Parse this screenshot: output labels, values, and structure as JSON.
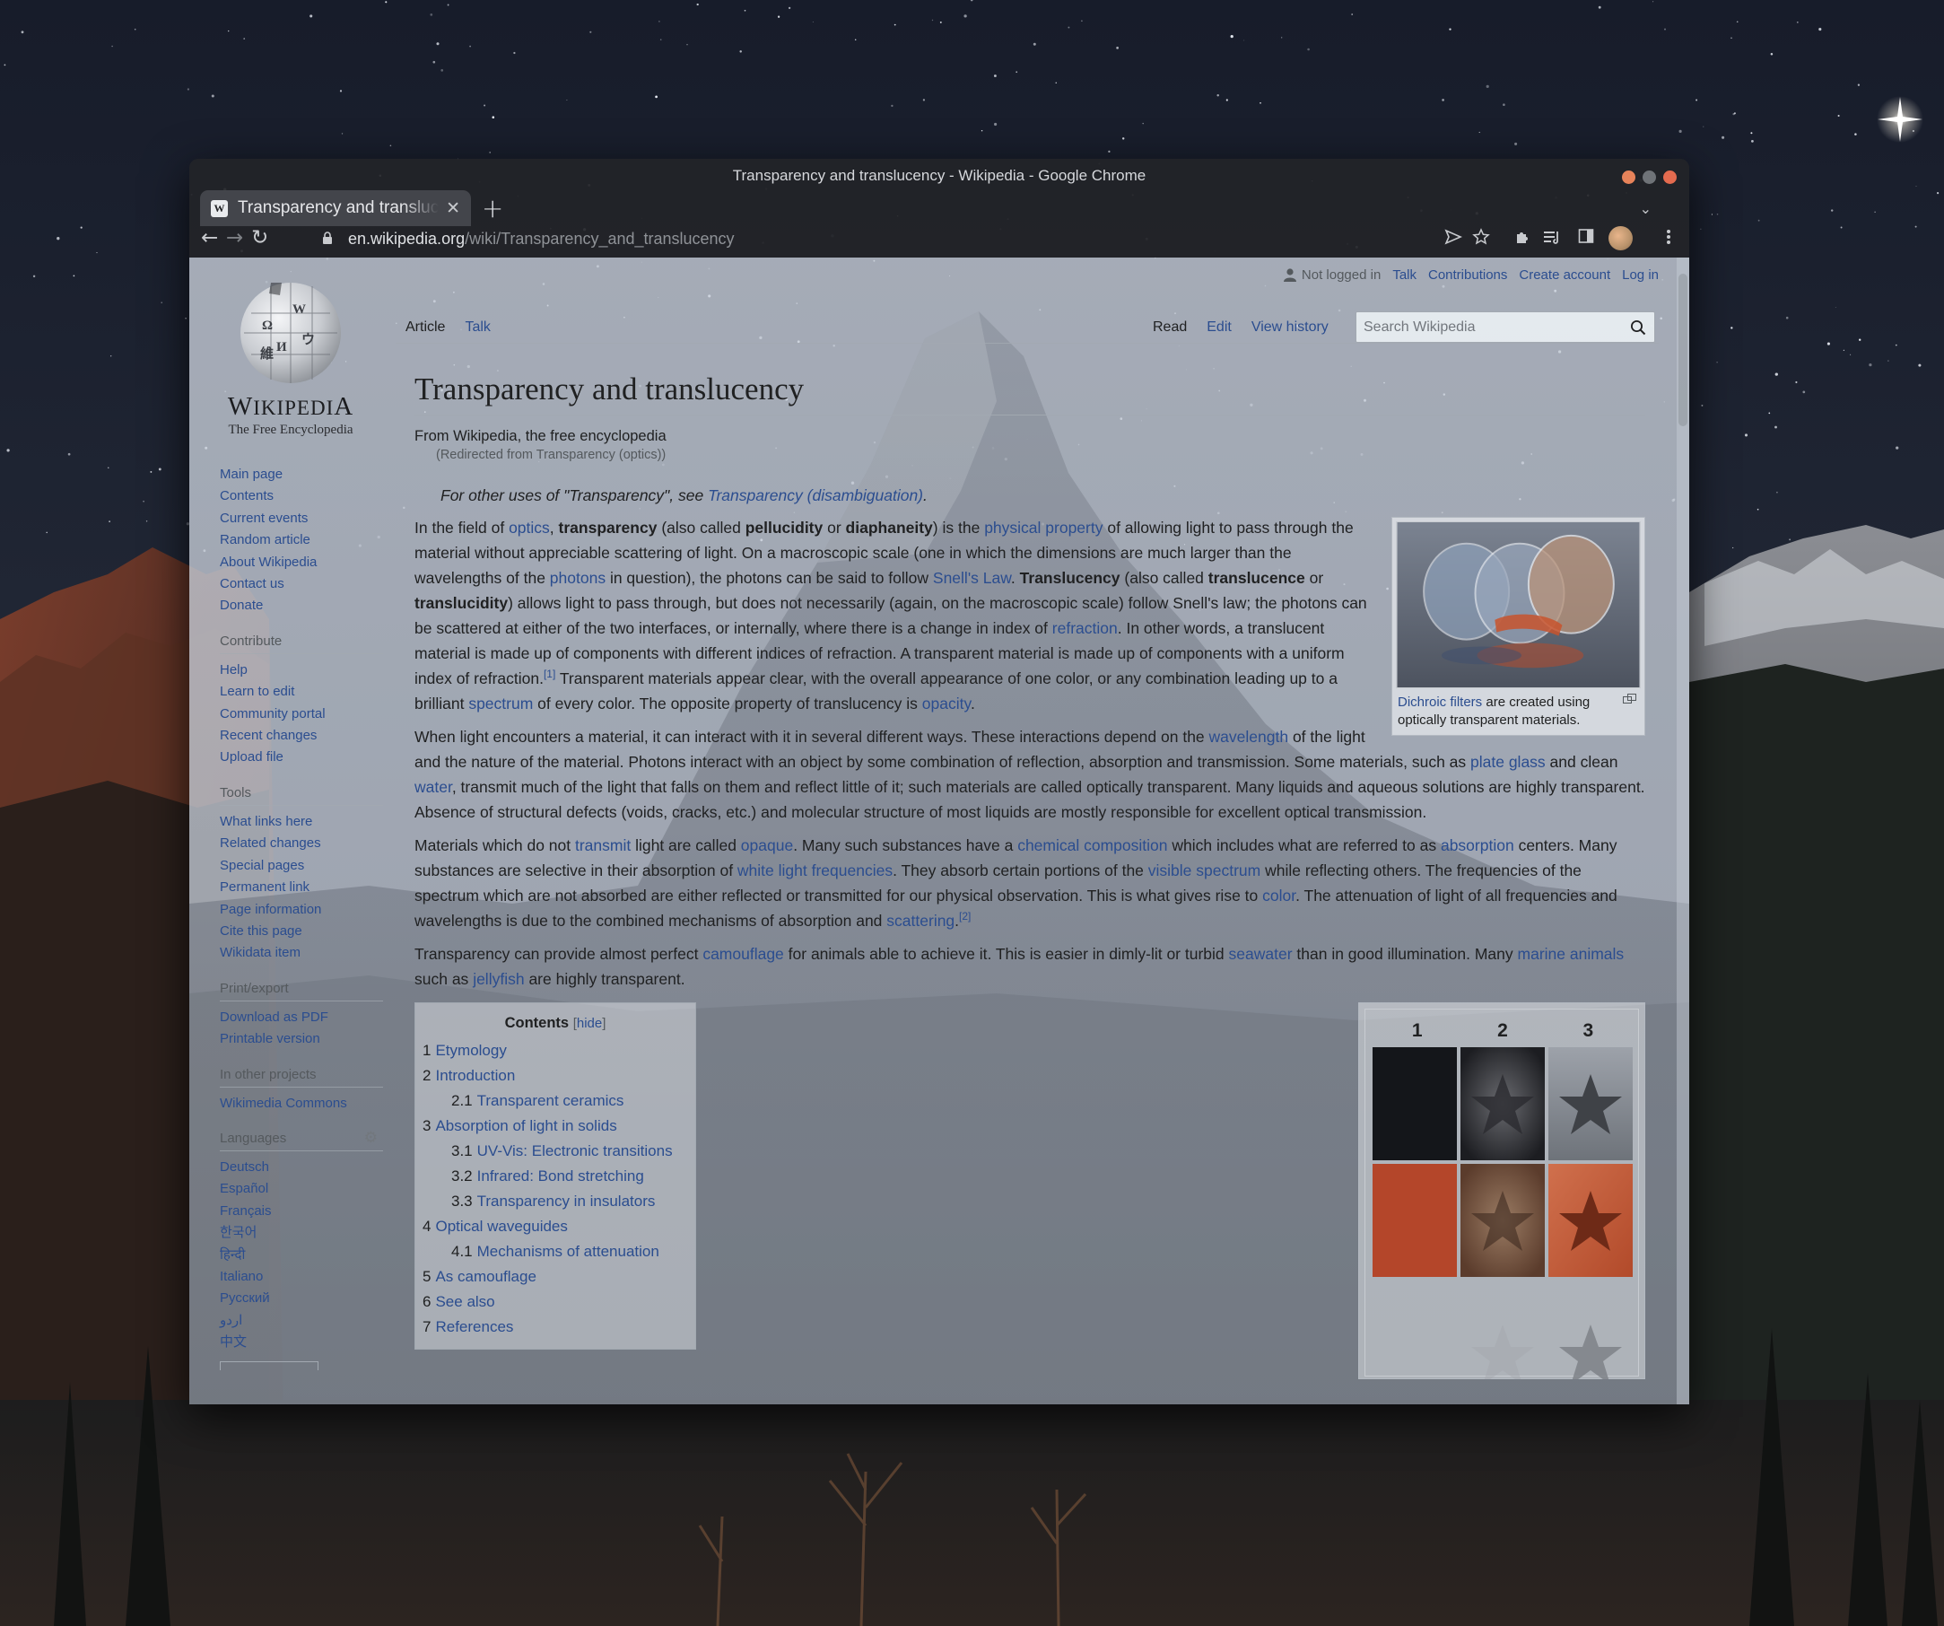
{
  "window": {
    "title": "Transparency and translucency - Wikipedia - Google Chrome",
    "dot_colors": [
      "#e7835a",
      "#6f7378",
      "#e46b4f"
    ]
  },
  "tab": {
    "title": "Transparency and translucency - Wikipedia",
    "favicon": "W",
    "close_glyph": "✕",
    "new_tab_glyph": "+",
    "list_glyph": "⌄"
  },
  "address": {
    "host": "en.wikipedia.org",
    "path": "/wiki/Transparency_and_translucency",
    "back_glyph": "←",
    "forward_glyph": "→",
    "reload_glyph": "↻"
  },
  "toolbar_icons": [
    "send-icon",
    "bookmark-star-icon",
    "extensions-icon",
    "reading-list-icon",
    "side-panel-icon",
    "profile-avatar",
    "menu-icon"
  ],
  "logo": {
    "wordmark": "WIKIPEDIA",
    "tagline": "The Free Encyclopedia"
  },
  "sidebar": {
    "main": [
      "Main page",
      "Contents",
      "Current events",
      "Random article",
      "About Wikipedia",
      "Contact us",
      "Donate"
    ],
    "contribute_head": "Contribute",
    "contribute": [
      "Help",
      "Learn to edit",
      "Community portal",
      "Recent changes",
      "Upload file"
    ],
    "tools_head": "Tools",
    "tools": [
      "What links here",
      "Related changes",
      "Special pages",
      "Permanent link",
      "Page information",
      "Cite this page",
      "Wikidata item"
    ],
    "print_head": "Print/export",
    "print": [
      "Download as PDF",
      "Printable version"
    ],
    "projects_head": "In other projects",
    "projects": [
      "Wikimedia Commons"
    ],
    "languages_head": "Languages",
    "languages": [
      "Deutsch",
      "Español",
      "Français",
      "한국어",
      "हिन्दी",
      "Italiano",
      "Русский",
      "اردو",
      "中文"
    ]
  },
  "userbar": {
    "not_logged": "Not logged in",
    "links": [
      "Talk",
      "Contributions",
      "Create account",
      "Log in"
    ]
  },
  "page_tabs": {
    "left": [
      "Article",
      "Talk"
    ],
    "right": [
      "Read",
      "Edit",
      "View history"
    ]
  },
  "search": {
    "placeholder": "Search Wikipedia"
  },
  "article": {
    "title": "Transparency and translucency",
    "from": "From Wikipedia, the free encyclopedia",
    "redirect": "(Redirected from Transparency (optics))",
    "hatnote_prefix": "For other uses of \"Transparency\", see ",
    "hatnote_link": "Transparency (disambiguation)",
    "hatnote_suffix": ".",
    "figure_caption_link": "Dichroic filters",
    "figure_caption_text": " are created using optically transparent materials.",
    "p1": [
      [
        "t",
        "In the field of "
      ],
      [
        "a",
        "optics"
      ],
      [
        "t",
        ", "
      ],
      [
        "b",
        "transparency"
      ],
      [
        "t",
        " (also called "
      ],
      [
        "b",
        "pellucidity"
      ],
      [
        "t",
        " or "
      ],
      [
        "b",
        "diaphaneity"
      ],
      [
        "t",
        ") is the "
      ],
      [
        "a",
        "physical property"
      ],
      [
        "t",
        " of allowing light to pass through the material without appreciable scattering of light. On a macroscopic scale (one in which the dimensions are much larger than the wavelengths of the "
      ],
      [
        "a",
        "photons"
      ],
      [
        "t",
        " in question), the photons can be said to follow "
      ],
      [
        "a",
        "Snell's Law"
      ],
      [
        "t",
        ". "
      ],
      [
        "b",
        "Translucency"
      ],
      [
        "t",
        " (also called "
      ],
      [
        "b",
        "translucence"
      ],
      [
        "t",
        " or "
      ],
      [
        "b",
        "translucidity"
      ],
      [
        "t",
        ") allows light to pass through, but does not necessarily (again, on the macroscopic scale) follow Snell's law; the photons can be scattered at either of the two interfaces, or internally, where there is a change in index of "
      ],
      [
        "a",
        "refraction"
      ],
      [
        "t",
        ". In other words, a translucent material is made up of components with different indices of refraction. A transparent material is made up of components with a uniform index of refraction."
      ],
      [
        "s",
        "[1]"
      ],
      [
        "t",
        " Transparent materials appear clear, with the overall appearance of one color, or any combination leading up to a brilliant "
      ],
      [
        "a",
        "spectrum"
      ],
      [
        "t",
        " of every color. The opposite property of translucency is "
      ],
      [
        "a",
        "opacity"
      ],
      [
        "t",
        "."
      ]
    ],
    "p2": [
      [
        "t",
        "When light encounters a material, it can interact with it in several different ways. These interactions depend on the "
      ],
      [
        "a",
        "wavelength"
      ],
      [
        "t",
        " of the light and the nature of the material. Photons interact with an object by some combination of reflection, absorption and transmission. Some materials, such as "
      ],
      [
        "a",
        "plate glass"
      ],
      [
        "t",
        " and clean "
      ],
      [
        "a",
        "water"
      ],
      [
        "t",
        ", transmit much of the light that falls on them and reflect little of it; such materials are called optically transparent. Many liquids and aqueous solutions are highly transparent. Absence of structural defects (voids, cracks, etc.) and molecular structure of most liquids are mostly responsible for excellent optical transmission."
      ]
    ],
    "p3": [
      [
        "t",
        "Materials which do not "
      ],
      [
        "a",
        "transmit"
      ],
      [
        "t",
        " light are called "
      ],
      [
        "a",
        "opaque"
      ],
      [
        "t",
        ". Many such substances have a "
      ],
      [
        "a",
        "chemical composition"
      ],
      [
        "t",
        " which includes what are referred to as "
      ],
      [
        "a",
        "absorption"
      ],
      [
        "t",
        " centers. Many substances are selective in their absorption of "
      ],
      [
        "a",
        "white light frequencies"
      ],
      [
        "t",
        ". They absorb certain portions of the "
      ],
      [
        "a",
        "visible spectrum"
      ],
      [
        "t",
        " while reflecting others. The frequencies of the spectrum which are not absorbed are either reflected or transmitted for our physical observation. This is what gives rise to "
      ],
      [
        "a",
        "color"
      ],
      [
        "t",
        ". The attenuation of light of all frequencies and wavelengths is due to the combined mechanisms of absorption and "
      ],
      [
        "a",
        "scattering"
      ],
      [
        "t",
        "."
      ],
      [
        "s",
        "[2]"
      ]
    ],
    "p4": [
      [
        "t",
        "Transparency can provide almost perfect "
      ],
      [
        "a",
        "camouflage"
      ],
      [
        "t",
        " for animals able to achieve it. This is easier in dimly-lit or turbid "
      ],
      [
        "a",
        "seawater"
      ],
      [
        "t",
        " than in good illumination. Many "
      ],
      [
        "a",
        "marine animals"
      ],
      [
        "t",
        " such as "
      ],
      [
        "a",
        "jellyfish"
      ],
      [
        "t",
        " are highly transparent."
      ]
    ]
  },
  "toc": {
    "title": "Contents",
    "hide_open": "[",
    "hide": "hide",
    "hide_close": "]",
    "items": [
      {
        "num": "1",
        "text": "Etymology",
        "level": 1
      },
      {
        "num": "2",
        "text": "Introduction",
        "level": 1
      },
      {
        "num": "2.1",
        "text": "Transparent ceramics",
        "level": 2
      },
      {
        "num": "3",
        "text": "Absorption of light in solids",
        "level": 1
      },
      {
        "num": "3.1",
        "text": "UV-Vis: Electronic transitions",
        "level": 2
      },
      {
        "num": "3.2",
        "text": "Infrared: Bond stretching",
        "level": 2
      },
      {
        "num": "3.3",
        "text": "Transparency in insulators",
        "level": 2
      },
      {
        "num": "4",
        "text": "Optical waveguides",
        "level": 1
      },
      {
        "num": "4.1",
        "text": "Mechanisms of attenuation",
        "level": 2
      },
      {
        "num": "5",
        "text": "As camouflage",
        "level": 1
      },
      {
        "num": "6",
        "text": "See also",
        "level": 1
      },
      {
        "num": "7",
        "text": "References",
        "level": 1
      }
    ]
  },
  "star_figure": {
    "labels": [
      "1",
      "2",
      "3"
    ]
  },
  "colors": {
    "link": "#2b4d8f",
    "text": "#202122"
  }
}
